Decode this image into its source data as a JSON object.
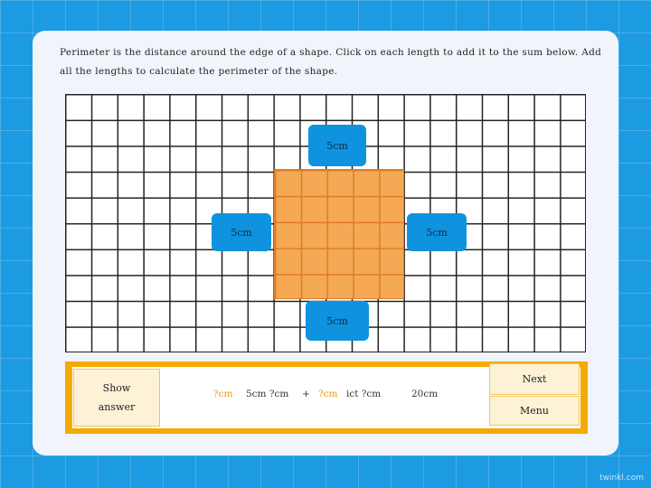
{
  "instructions": "Perimeter is the distance around the edge of a shape. Click on each length to add it to the sum below. Add all the lengths to calculate the perimeter of the shape.",
  "lengths": {
    "top": "5cm",
    "left": "5cm",
    "right": "5cm",
    "bottom": "5cm"
  },
  "sum": {
    "show_answer_line1": "Show",
    "show_answer_line2": "answer",
    "tokens": [
      "?cm",
      "5cm ?cm",
      "+",
      "?cm",
      "ict ?cm",
      "20cm"
    ]
  },
  "nav": {
    "next": "Next",
    "menu": "Menu"
  },
  "watermark": "twinkl.com",
  "colors": {
    "background": "#1d9be2",
    "shape_fill": "#f5a955",
    "length_button": "#0f93de",
    "sum_bar": "#f4aa00",
    "placeholder_text": "#e8961c"
  }
}
